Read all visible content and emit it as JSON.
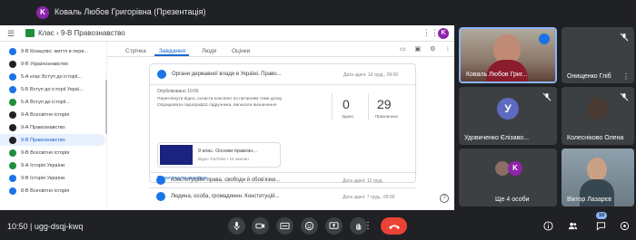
{
  "presentation": {
    "avatar_letter": "K",
    "title": "Коваль Любов Григорівна (Презентація)"
  },
  "classroom": {
    "breadcrumb": "Клас  ›  9-В Правознавство",
    "account_letter": "K",
    "tabs": [
      {
        "label": "Стрічка"
      },
      {
        "label": "Завдання"
      },
      {
        "label": "Люди"
      },
      {
        "label": "Оцінки"
      }
    ],
    "sidebar": [
      {
        "label": "9-В Козацтво: життя в пери...",
        "color": "#1a73e8"
      },
      {
        "label": "9-В Українознавство",
        "color": "#202124"
      },
      {
        "label": "5-А клас Вступ до історії...",
        "color": "#1a73e8"
      },
      {
        "label": "5-Б Вступ до історії Украї...",
        "color": "#1a73e8"
      },
      {
        "label": "5-А Вступ до історії...",
        "color": "#1e8e3e"
      },
      {
        "label": "9-А Всесвітня історія",
        "color": "#202124"
      },
      {
        "label": "9-А Правознавство",
        "color": "#202124"
      },
      {
        "label": "9-В Правознавство",
        "color": "#202124"
      },
      {
        "label": "9-В Всесвітня історія",
        "color": "#1e8e3e"
      },
      {
        "label": "9-А Історія України",
        "color": "#1e8e3e"
      },
      {
        "label": "9-В Історія України",
        "color": "#1a73e8"
      },
      {
        "label": "8-В Всесвітня історія",
        "color": "#1a73e8"
      }
    ],
    "task1": {
      "title": "Органи державної влади в Україні. Право...",
      "due": "Дата здачі: 19 груд., 09:00",
      "published": "Опубліковано 10:56",
      "description": "Переглянути відео, скласти конспект по питанням теми уроку. Опрацювати параграф11 підручника, виписати визначення",
      "submitted_num": "0",
      "submitted_label": "Здано",
      "assigned_num": "29",
      "assigned_label": "Призначено",
      "video_title": "9 клас. Основи правозн...",
      "video_sub": "Відео YouTube • 14 хвилин",
      "link": "Переглянути вказівки"
    },
    "task2": {
      "title": "Конституційні права, свободи й обов'язки...",
      "due": "Дата здачі: 12 груд."
    },
    "task3": {
      "title": "Людина, особа, громадянин. Конституцій...",
      "due": "Дата здачі: 7 груд., 09:00"
    }
  },
  "participants": [
    {
      "name": "Коваль Любов Григ...",
      "kind": "video"
    },
    {
      "name": "Онищенко Гліб",
      "kind": "blank"
    },
    {
      "name": "Удовиченко Єлізаво...",
      "kind": "avatar",
      "letter": "У",
      "color": "#5c6bc0"
    },
    {
      "name": "Колесніково Олена",
      "kind": "photo"
    },
    {
      "name": "Ще 4 особи",
      "kind": "group",
      "letter": "K"
    },
    {
      "name": "Віктор Лазарєв",
      "kind": "video"
    }
  ],
  "meeting": {
    "time": "10:50",
    "separator": "|",
    "code": "ugg-dsqj-kwq",
    "participant_count": "10"
  },
  "colors": {
    "accent": "#1967d2",
    "end_call": "#ea4335",
    "tile_bg": "#3c4043"
  }
}
